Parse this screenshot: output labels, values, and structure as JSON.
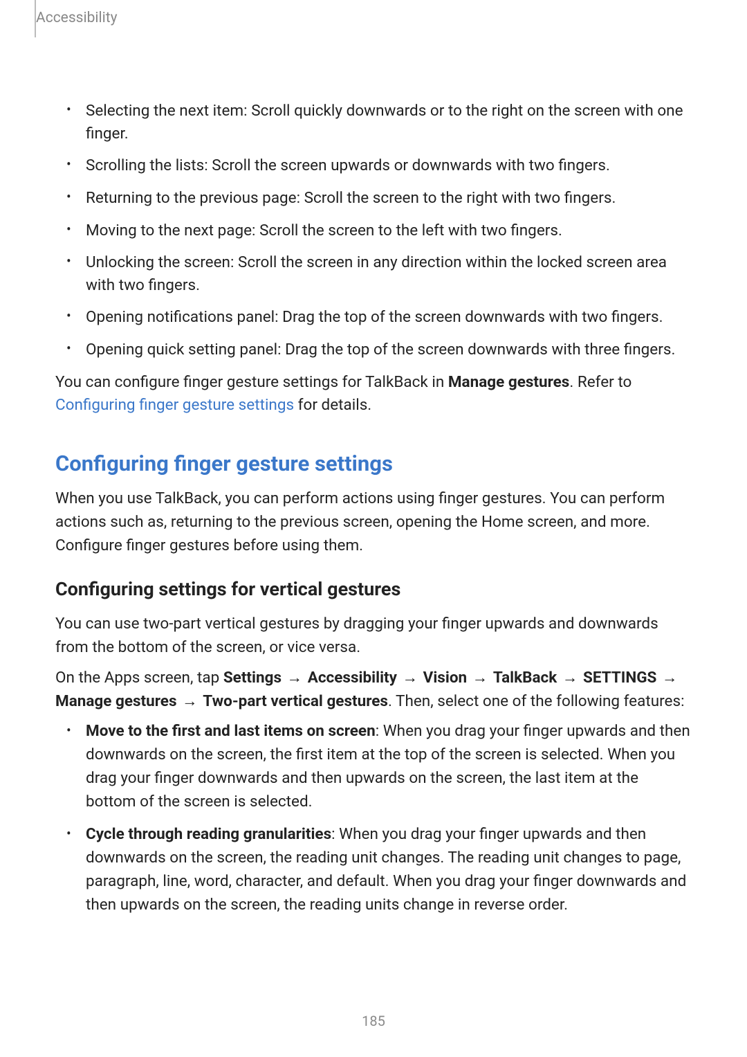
{
  "header": {
    "section": "Accessibility"
  },
  "gestures": [
    "Selecting the next item: Scroll quickly downwards or to the right on the screen with one finger.",
    "Scrolling the lists: Scroll the screen upwards or downwards with two fingers.",
    "Returning to the previous page: Scroll the screen to the right with two fingers.",
    "Moving to the next page: Scroll the screen to the left with two fingers.",
    "Unlocking the screen: Scroll the screen in any direction within the locked screen area with two fingers.",
    "Opening notifications panel: Drag the top of the screen downwards with two fingers.",
    "Opening quick setting panel: Drag the top of the screen downwards with three fingers."
  ],
  "configure_note": {
    "pre": "You can configure finger gesture settings for TalkBack in ",
    "bold": "Manage gestures",
    "mid": ". Refer to ",
    "link": "Configuring finger gesture settings",
    "post": " for details."
  },
  "section": {
    "title": "Configuring finger gesture settings",
    "desc": "When you use TalkBack, you can perform actions using finger gestures. You can perform actions such as, returning to the previous screen, opening the Home screen, and more. Configure finger gestures before using them."
  },
  "sub": {
    "title": "Configuring settings for vertical gestures",
    "para1": "You can use two-part vertical gestures by dragging your finger upwards and downwards from the bottom of the screen, or vice versa.",
    "path": {
      "pre": "On the Apps screen, tap ",
      "steps": [
        "Settings",
        "Accessibility",
        "Vision",
        "TalkBack",
        "SETTINGS",
        "Manage gestures",
        "Two-part vertical gestures"
      ],
      "post": ". Then, select one of the following features:"
    }
  },
  "features": [
    {
      "term": "Move to the first and last items on screen",
      "desc": ": When you drag your finger upwards and then downwards on the screen, the first item at the top of the screen is selected. When you drag your finger downwards and then upwards on the screen, the last item at the bottom of the screen is selected."
    },
    {
      "term": "Cycle through reading granularities",
      "desc": ": When you drag your finger upwards and then downwards on the screen, the reading unit changes. The reading unit changes to page, paragraph, line, word, character, and default. When you drag your finger downwards and then upwards on the screen, the reading units change in reverse order."
    }
  ],
  "page_number": "185",
  "arrow": "→"
}
